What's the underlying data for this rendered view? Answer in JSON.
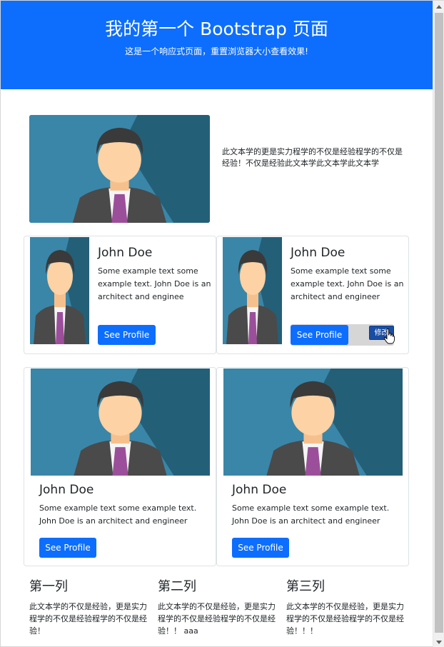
{
  "jumbotron": {
    "title": "我的第一个 Bootstrap 页面",
    "subtitle": "这是一个响应式页面，重置浏览器大小查看效果!",
    "color": "#0d6efd"
  },
  "hero": {
    "text": "此文本学的更是实力程学的不仅是经验程学的不仅是经验！不仅是经验此文本学此文本学此文本学"
  },
  "cards_horizontal": [
    {
      "title": "John Doe",
      "text": "Some example text some example text. John Doe is an architect and enginee",
      "button": "See Profile"
    },
    {
      "title": "John Doe",
      "text": "Some example text some example text. John Doe is an architect and engineer",
      "button": "See Profile",
      "edit_button": "修改"
    }
  ],
  "cards_vertical": [
    {
      "title": "John Doe",
      "text": "Some example text some example text. John Doe is an architect and engineer",
      "button": "See Profile"
    },
    {
      "title": "John Doe",
      "text": "Some example text some example text. John Doe is an architect and engineer",
      "button": "See Profile"
    }
  ],
  "columns": [
    {
      "heading": "第一列",
      "text": "此文本学的不仅是经验，更是实力程学的不仅是经验程学的不仅是经验！"
    },
    {
      "heading": "第二列",
      "text": "此文本学的不仅是经验，更是实力程学的不仅是经验程学的不仅是经验！！ aaa"
    },
    {
      "heading": "第三列",
      "text": "此文本学的不仅是经验，更是实力程学的不仅是经验程学的不仅是经验！！！"
    }
  ],
  "colors": {
    "primary": "#0d6efd",
    "avatar_bg": "#2c6d8a"
  },
  "icons": {
    "avatar": "person-avatar-icon",
    "cursor": "hand-pointer-icon"
  }
}
